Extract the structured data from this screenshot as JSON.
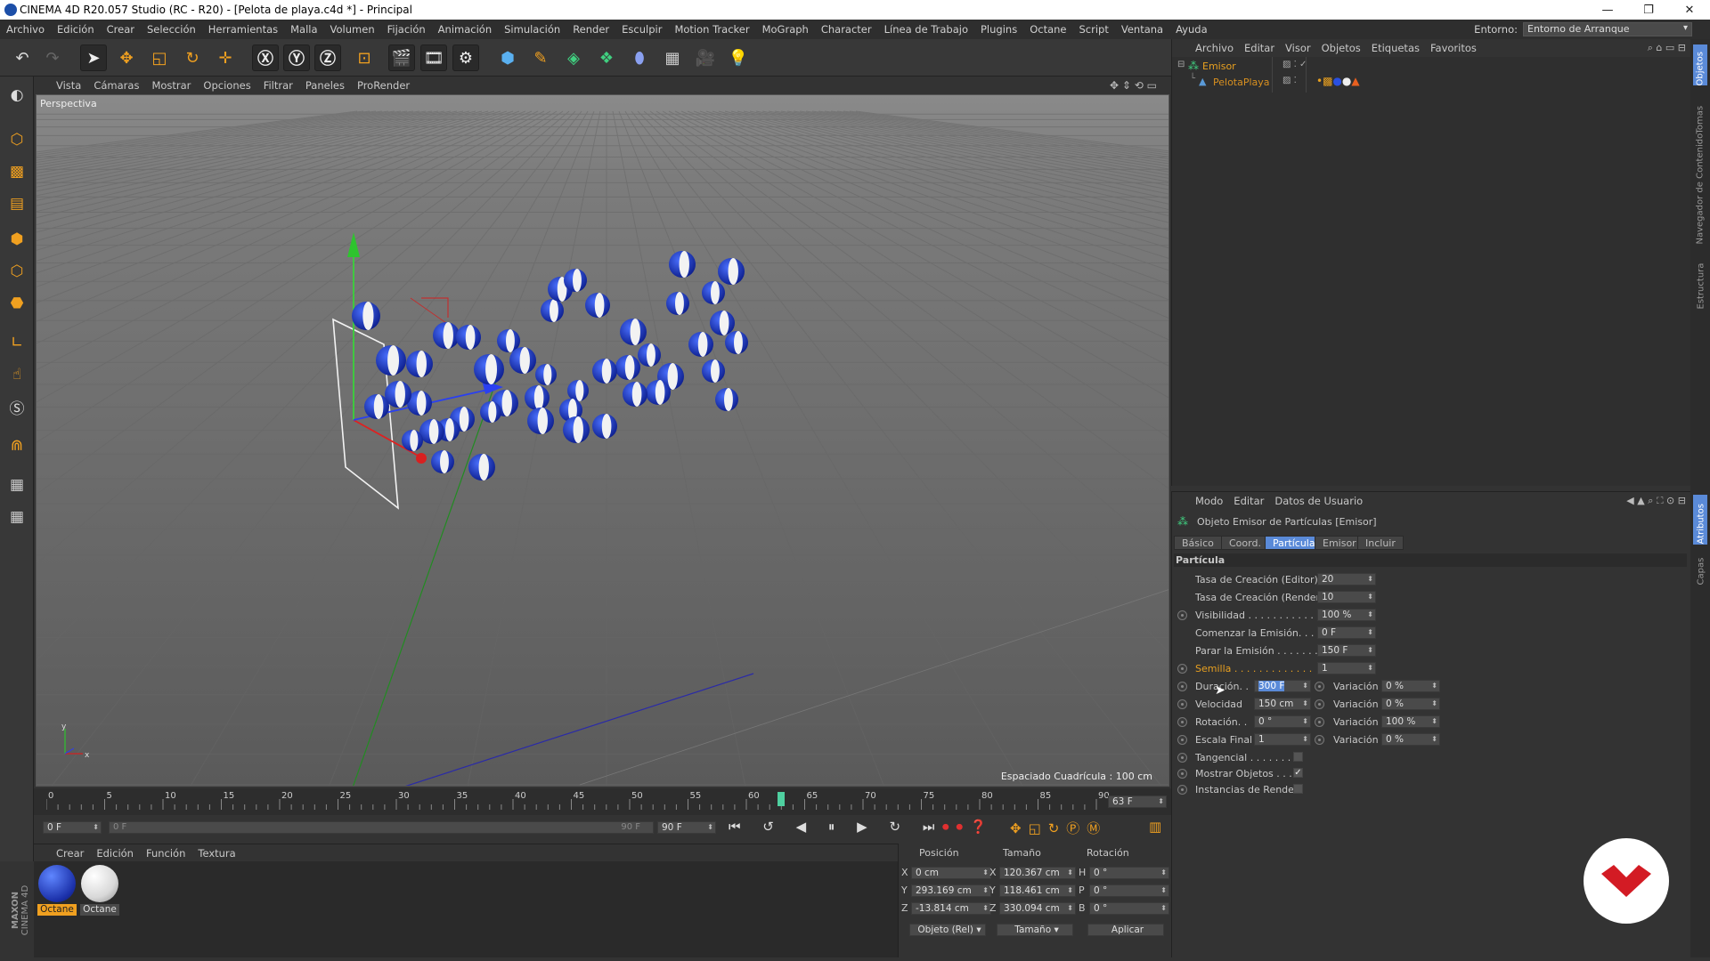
{
  "window": {
    "title": "CINEMA 4D R20.057 Studio (RC - R20) - [Pelota de playa.c4d *] - Principal"
  },
  "menubar": {
    "items": [
      "Archivo",
      "Edición",
      "Crear",
      "Selección",
      "Herramientas",
      "Malla",
      "Volumen",
      "Fijación",
      "Animación",
      "Simulación",
      "Render",
      "Esculpir",
      "Motion Tracker",
      "MoGraph",
      "Character",
      "Línea de Trabajo",
      "Plugins",
      "Octane",
      "Script",
      "Ventana",
      "Ayuda"
    ],
    "env_label": "Entorno:",
    "env_value": "Entorno de Arranque"
  },
  "viewport": {
    "menu": [
      "Vista",
      "Cámaras",
      "Mostrar",
      "Opciones",
      "Filtrar",
      "Paneles",
      "ProRender"
    ],
    "view_name": "Perspectiva",
    "grid_spacing": "Espaciado Cuadrícula : 100 cm"
  },
  "timeline": {
    "ticks": [
      "0",
      "5",
      "10",
      "15",
      "20",
      "25",
      "30",
      "35",
      "40",
      "45",
      "50",
      "55",
      "60",
      "65",
      "70",
      "75",
      "80",
      "85",
      "90"
    ],
    "current_frame": "63 F",
    "playhead_frame": 63,
    "start_field": "0 F",
    "range_start": "0 F",
    "range_end": "90 F",
    "end_field": "90 F"
  },
  "materials": {
    "menu": [
      "Crear",
      "Edición",
      "Función",
      "Textura"
    ],
    "items": [
      {
        "label": "Octane",
        "color": "#1f3fbf",
        "selected": true
      },
      {
        "label": "Octane",
        "color": "#e8e8e8",
        "selected": false
      }
    ],
    "brand_line1": "MAXON",
    "brand_line2": "CINEMA 4D"
  },
  "coords": {
    "headers": [
      "Posición",
      "Tamaño",
      "Rotación"
    ],
    "rows": [
      {
        "axis": "X",
        "pos": "0 cm",
        "size_axis": "X",
        "size": "120.367 cm",
        "rot_axis": "H",
        "rot": "0 °"
      },
      {
        "axis": "Y",
        "pos": "293.169 cm",
        "size_axis": "Y",
        "size": "118.461 cm",
        "rot_axis": "P",
        "rot": "0 °"
      },
      {
        "axis": "Z",
        "pos": "-13.814 cm",
        "size_axis": "Z",
        "size": "330.094 cm",
        "rot_axis": "B",
        "rot": "0 °"
      }
    ],
    "mode_dropdown": "Objeto (Rel)",
    "size_dropdown": "Tamaño",
    "apply_button": "Aplicar"
  },
  "object_manager": {
    "menu": [
      "Archivo",
      "Editar",
      "Visor",
      "Objetos",
      "Etiquetas",
      "Favoritos"
    ],
    "objects": [
      {
        "name": "Emisor",
        "color": "#e8a020",
        "level": 0
      },
      {
        "name": "PelotaPlaya",
        "color": "#d89020",
        "level": 1
      }
    ]
  },
  "attributes": {
    "menu": [
      "Modo",
      "Editar",
      "Datos de Usuario"
    ],
    "object_title": "Objeto Emisor de Partículas  [Emisor]",
    "tabs": [
      "Básico",
      "Coord.",
      "Partícula",
      "Emisor",
      "Incluir"
    ],
    "active_tab": "Partícula",
    "section": "Partícula",
    "params": [
      {
        "label": "Tasa de Creación (Editor)",
        "value": "20"
      },
      {
        "label": "Tasa de Creación (Render)",
        "value": "10"
      },
      {
        "label": "Visibilidad . . . . . . . . . . .",
        "value": "100 %"
      },
      {
        "label": "Comenzar la Emisión. . . .",
        "value": "0 F"
      },
      {
        "label": "Parar la Emisión . . . . . . .",
        "value": "150 F"
      },
      {
        "label": "Semilla . . . . . . . . . . . . .",
        "value": "1"
      }
    ],
    "paired": [
      {
        "label": "Duración. .",
        "value": "300 F",
        "var_label": "Variación",
        "var_value": "0 %"
      },
      {
        "label": "Velocidad",
        "value": "150 cm",
        "var_label": "Variación",
        "var_value": "0 %"
      },
      {
        "label": "Rotación. .",
        "value": "0 °",
        "var_label": "Variación",
        "var_value": "100 %"
      },
      {
        "label": "Escala Final",
        "value": "1",
        "var_label": "Variación",
        "var_value": "0 %"
      }
    ],
    "checks": [
      {
        "label": "Tangencial . . . . . . . .",
        "checked": false
      },
      {
        "label": "Mostrar Objetos . . . .",
        "checked": true
      },
      {
        "label": "Instancias de Render",
        "checked": false
      }
    ]
  },
  "right_strip": {
    "top_tabs": [
      "Objetos",
      "Tomas",
      "Navegador de Contenido",
      "Estructura"
    ],
    "bottom_tabs": [
      "Atributos",
      "Capas"
    ]
  }
}
